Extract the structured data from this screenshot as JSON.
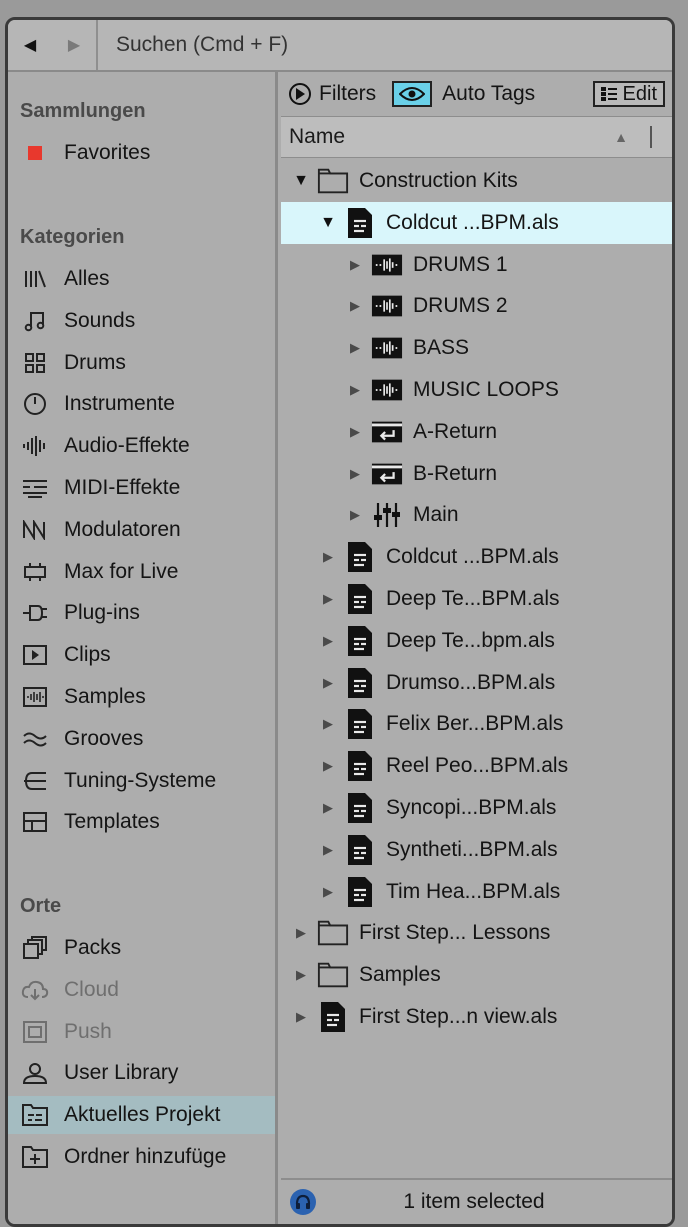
{
  "search": {
    "placeholder": "Suchen (Cmd + F)"
  },
  "sidebar": {
    "collections_title": "Sammlungen",
    "favorites_label": "Favorites",
    "favorites_color": "#e8382d",
    "categories_title": "Kategorien",
    "categories": [
      {
        "label": "Alles",
        "icon": "all-icon"
      },
      {
        "label": "Sounds",
        "icon": "note-icon"
      },
      {
        "label": "Drums",
        "icon": "drum-grid-icon"
      },
      {
        "label": "Instrumente",
        "icon": "power-icon"
      },
      {
        "label": "Audio-Effekte",
        "icon": "waveform-icon"
      },
      {
        "label": "MIDI-Effekte",
        "icon": "midi-icon"
      },
      {
        "label": "Modulatoren",
        "icon": "modulator-icon"
      },
      {
        "label": "Max for Live",
        "icon": "max-icon"
      },
      {
        "label": "Plug-ins",
        "icon": "plug-icon"
      },
      {
        "label": "Clips",
        "icon": "clip-play-icon"
      },
      {
        "label": "Samples",
        "icon": "sample-icon"
      },
      {
        "label": "Grooves",
        "icon": "groove-icon"
      },
      {
        "label": "Tuning-Systeme",
        "icon": "tuning-icon"
      },
      {
        "label": "Templates",
        "icon": "template-icon"
      }
    ],
    "places_title": "Orte",
    "places": [
      {
        "label": "Packs",
        "icon": "packs-icon"
      },
      {
        "label": "Cloud",
        "icon": "cloud-icon"
      },
      {
        "label": "Push",
        "icon": "push-icon"
      },
      {
        "label": "User Library",
        "icon": "user-icon"
      },
      {
        "label": "Aktuelles Projekt",
        "icon": "project-folder-icon"
      },
      {
        "label": "Ordner hinzufüge",
        "icon": "add-folder-icon"
      }
    ]
  },
  "toolbar": {
    "filters_label": "Filters",
    "autotags_label": "Auto Tags",
    "edit_label": "Edit",
    "eye_color": "#6ad0e8"
  },
  "columns": {
    "name": "Name"
  },
  "tree": [
    {
      "label": "Construction Kits",
      "icon": "folder-icon",
      "level": 0,
      "expanded": true
    },
    {
      "label": "Coldcut ...BPM.als",
      "icon": "live-set-icon",
      "level": 1,
      "expanded": true,
      "selected": true
    },
    {
      "label": "DRUMS 1",
      "icon": "audio-track-icon",
      "level": 2
    },
    {
      "label": "DRUMS 2",
      "icon": "audio-track-icon",
      "level": 2
    },
    {
      "label": "BASS",
      "icon": "audio-track-icon",
      "level": 2
    },
    {
      "label": "MUSIC LOOPS",
      "icon": "audio-track-icon",
      "level": 2
    },
    {
      "label": "A-Return",
      "icon": "return-track-icon",
      "level": 2
    },
    {
      "label": "B-Return",
      "icon": "return-track-icon",
      "level": 2
    },
    {
      "label": "Main",
      "icon": "mixer-icon",
      "level": 2
    },
    {
      "label": "Coldcut ...BPM.als",
      "icon": "live-set-icon",
      "level": 1
    },
    {
      "label": "Deep Te...BPM.als",
      "icon": "live-set-icon",
      "level": 1
    },
    {
      "label": "Deep Te...bpm.als",
      "icon": "live-set-icon",
      "level": 1
    },
    {
      "label": "Drumso...BPM.als",
      "icon": "live-set-icon",
      "level": 1
    },
    {
      "label": "Felix Ber...BPM.als",
      "icon": "live-set-icon",
      "level": 1
    },
    {
      "label": "Reel Peo...BPM.als",
      "icon": "live-set-icon",
      "level": 1
    },
    {
      "label": "Syncopi...BPM.als",
      "icon": "live-set-icon",
      "level": 1
    },
    {
      "label": "Syntheti...BPM.als",
      "icon": "live-set-icon",
      "level": 1
    },
    {
      "label": "Tim Hea...BPM.als",
      "icon": "live-set-icon",
      "level": 1
    },
    {
      "label": "First Step... Lessons",
      "icon": "folder-icon",
      "level": 0
    },
    {
      "label": "Samples",
      "icon": "folder-icon",
      "level": 0
    },
    {
      "label": "First Step...n view.als",
      "icon": "live-set-icon",
      "level": 0
    }
  ],
  "status": {
    "text": "1 item selected",
    "help_color": "#2b62b0"
  }
}
